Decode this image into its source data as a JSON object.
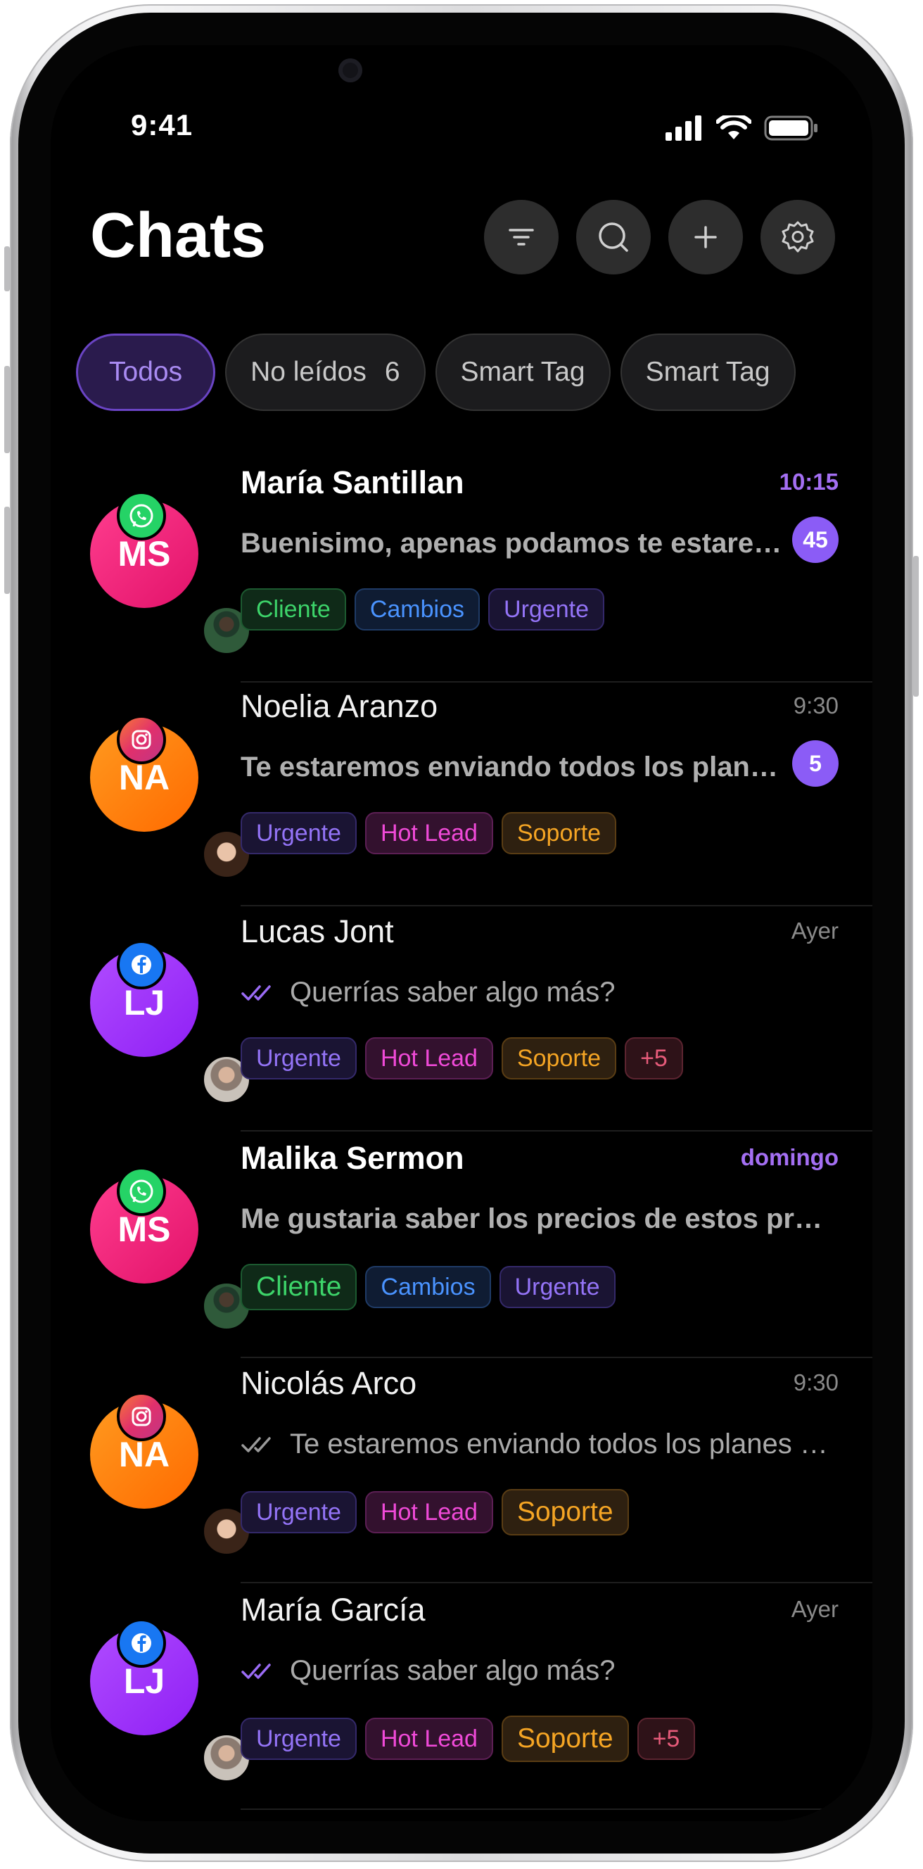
{
  "status": {
    "time": "9:41"
  },
  "header": {
    "title": "Chats"
  },
  "toolbar": [
    "filter-icon",
    "search-icon",
    "add-icon",
    "settings-icon"
  ],
  "filters": {
    "all": "Todos",
    "unread": "No leídos",
    "unread_count": "6",
    "smart1": "Smart Tag",
    "smart2": "Smart Tag"
  },
  "colors": {
    "accent": "#8b5cf6",
    "whatsapp": "#25d366",
    "instagram": "#e1306c",
    "facebook": "#1877f2",
    "tag_cliente": "#34c759",
    "tag_cambios": "#3d8bfd",
    "tag_urgente": "#8b6cf6",
    "tag_hotlead": "#e93fd0",
    "tag_soporte": "#f5a524",
    "tag_more": "#e65b7a"
  },
  "chats": [
    {
      "name": "María Santillan",
      "initials": "MS",
      "time": "10:15",
      "preview": "Buenisimo, apenas podamos te estaremos enviando",
      "unread": "45",
      "channel": "whatsapp",
      "tags": [
        "Cliente",
        "Cambios",
        "Urgente"
      ]
    },
    {
      "name": "Noelia Aranzo",
      "initials": "NA",
      "time": "9:30",
      "preview": "Te estaremos enviando todos los planes disponibles",
      "unread": "5",
      "channel": "instagram",
      "tags": [
        "Urgente",
        "Hot Lead",
        "Soporte"
      ]
    },
    {
      "name": "Lucas Jont",
      "initials": "LJ",
      "time": "Ayer",
      "preview": "Querrías saber algo más?",
      "channel": "facebook",
      "tags": [
        "Urgente",
        "Hot Lead",
        "Soporte",
        "+5"
      ]
    },
    {
      "name": "Malika Sermon",
      "initials": "MS",
      "time": "domingo",
      "preview": "Me gustaria saber los precios de estos productos",
      "channel": "whatsapp",
      "tags": [
        "Cliente",
        "Cambios",
        "Urgente"
      ]
    },
    {
      "name": "Nicolás Arco",
      "initials": "NA",
      "time": "9:30",
      "preview": "Te estaremos enviando todos los planes disponibles",
      "channel": "instagram",
      "tags": [
        "Urgente",
        "Hot Lead",
        "Soporte"
      ]
    },
    {
      "name": "María García",
      "initials": "LJ",
      "time": "Ayer",
      "preview": "Querrías saber algo más?",
      "channel": "facebook",
      "tags": [
        "Urgente",
        "Hot Lead",
        "Soporte",
        "+5"
      ]
    }
  ]
}
